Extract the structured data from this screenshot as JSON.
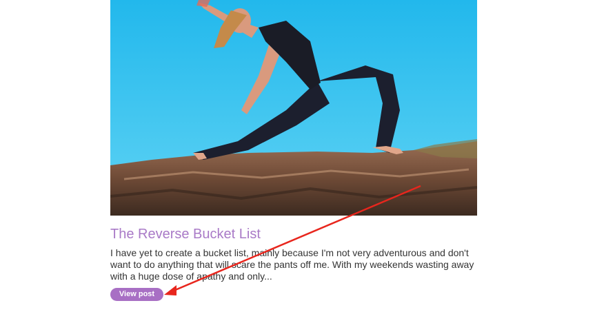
{
  "post": {
    "title": "The Reverse Bucket List",
    "excerpt": "I have yet to create a bucket list, mainly because I'm not very adventurous and don't want to do anything that will scare the pants off me. With my weekends wasting away with a huge dose of apathy and only...",
    "button_label": "View post"
  },
  "colors": {
    "title": "#a97ac7",
    "button": "#a86fc4",
    "annotation_arrow": "#e8261d"
  }
}
